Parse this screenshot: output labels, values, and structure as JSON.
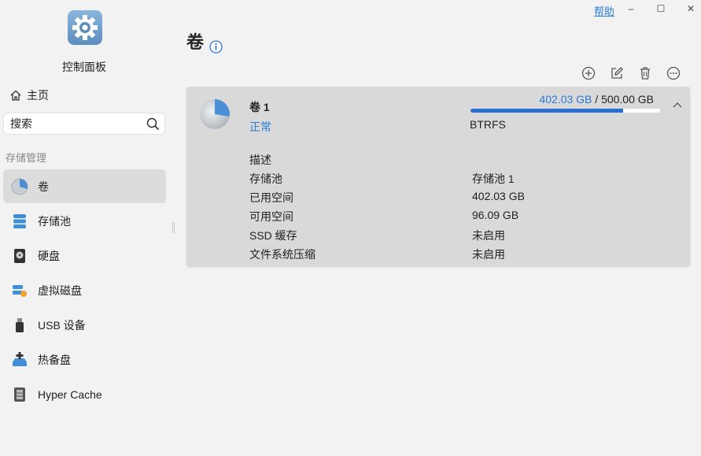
{
  "window": {
    "help_label": "帮助",
    "minimize": "–",
    "maximize": "☐",
    "close": "✕"
  },
  "sidebar": {
    "app_title": "控制面板",
    "home_label": "主页",
    "search": {
      "value": "搜索"
    },
    "section_label": "存储管理",
    "items": [
      {
        "label": "卷",
        "icon": "pie-chart-icon",
        "active": true
      },
      {
        "label": "存储池",
        "icon": "storage-pool-icon"
      },
      {
        "label": "硬盘",
        "icon": "hard-disk-icon"
      },
      {
        "label": "虚拟磁盘",
        "icon": "virtual-disk-icon"
      },
      {
        "label": "USB 设备",
        "icon": "usb-icon"
      },
      {
        "label": "热备盘",
        "icon": "hot-spare-icon"
      },
      {
        "label": "Hyper Cache",
        "icon": "hyper-cache-icon"
      }
    ]
  },
  "main": {
    "title": "卷",
    "toolbar_icons": [
      "add-icon",
      "edit-icon",
      "delete-icon",
      "more-icon"
    ],
    "volume": {
      "name": "卷 1",
      "status": "正常",
      "used": "402.03 GB",
      "separator": " / ",
      "total": "500.00 GB",
      "used_fraction": 0.804,
      "filesystem": "BTRFS",
      "collapse_icon": "chevron-up-icon",
      "details": [
        {
          "label": "描述",
          "value": ""
        },
        {
          "label": "存储池",
          "value": "存储池 1"
        },
        {
          "label": "已用空间",
          "value": "402.03 GB"
        },
        {
          "label": "可用空间",
          "value": "96.09 GB"
        },
        {
          "label": "SSD 缓存",
          "value": "未启用"
        },
        {
          "label": "文件系统压缩",
          "value": "未启用"
        }
      ]
    }
  },
  "colors": {
    "accent": "#2a7ad6",
    "progress": "#2b6ed2",
    "active_nav": "#dcdcdc",
    "card": "#d9d9d9"
  }
}
